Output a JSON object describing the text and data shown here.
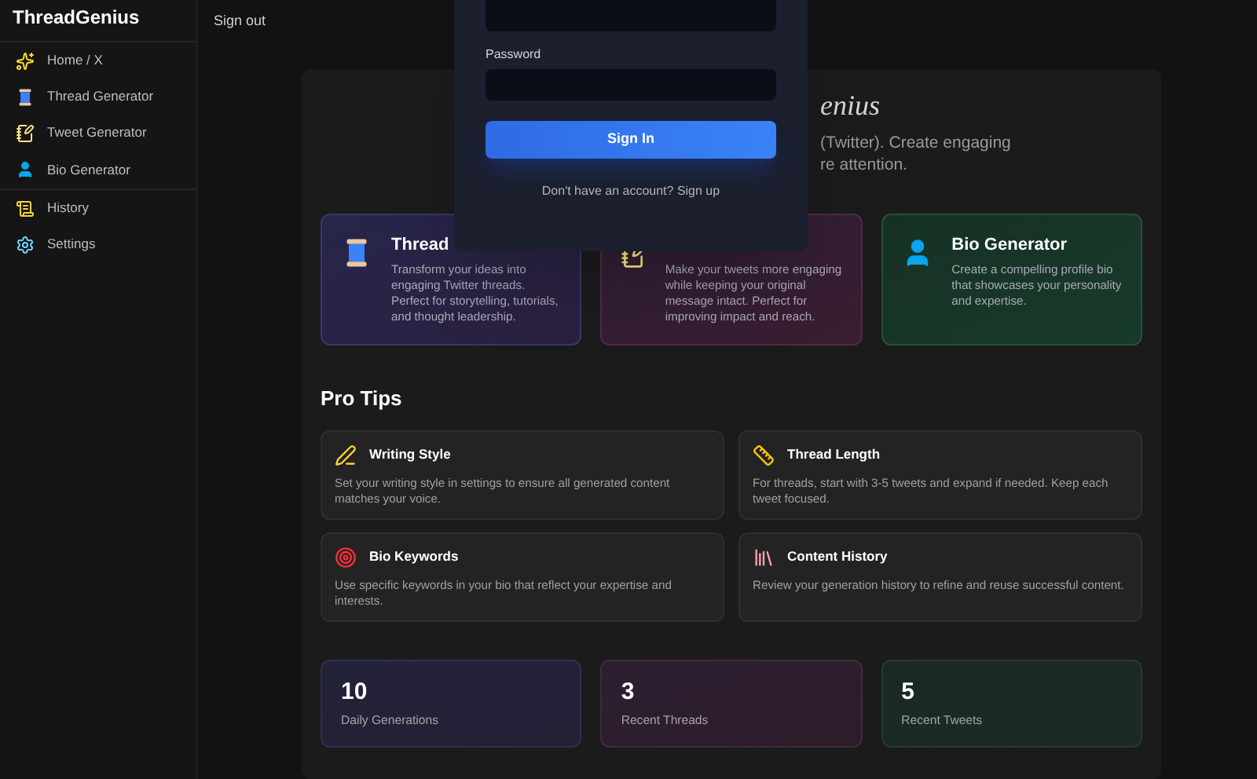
{
  "sidebar": {
    "brand": "ThreadGenius",
    "items": [
      {
        "label": "Home / X",
        "selected": false
      },
      {
        "label": "Thread Generator",
        "selected": false
      },
      {
        "label": "Tweet Generator",
        "selected": false
      },
      {
        "label": "Bio Generator",
        "selected": false
      },
      {
        "label": "History",
        "selected": false
      },
      {
        "label": "Settings",
        "selected": false
      }
    ]
  },
  "topbar": {
    "sign_out": "Sign out"
  },
  "hero": {
    "title": "enius",
    "subtitle_lines": [
      "(Twitter). Create engaging",
      "re attention."
    ]
  },
  "features": [
    {
      "title": "Thread",
      "description": "Transform your ideas into engaging Twitter threads. Perfect for storytelling, tutorials, and thought leadership."
    },
    {
      "description": "Make your tweets more engaging while keeping your original message intact. Perfect for improving impact and reach."
    },
    {
      "title": "Bio Generator",
      "description": "Create a compelling profile bio that showcases your personality and expertise."
    }
  ],
  "pro_tips": {
    "heading": "Pro Tips",
    "tips": [
      {
        "title": "Writing Style",
        "text": "Set your writing style in settings to ensure all generated content matches your voice."
      },
      {
        "title": "Thread Length",
        "text": "For threads, start with 3-5 tweets and expand if needed. Keep each tweet focused."
      },
      {
        "title": "Bio Keywords",
        "text": "Use specific keywords in your bio that reflect your expertise and interests."
      },
      {
        "title": "Content History",
        "text": "Review your generation history to refine and reuse successful content."
      }
    ]
  },
  "stats": [
    {
      "value": "10",
      "label": "Daily Generations"
    },
    {
      "value": "3",
      "label": "Recent Threads"
    },
    {
      "value": "5",
      "label": "Recent Tweets"
    }
  ],
  "login_modal": {
    "password_label": "Password",
    "submit": "Sign In",
    "signup_prompt": "Don't have an account? Sign up"
  }
}
